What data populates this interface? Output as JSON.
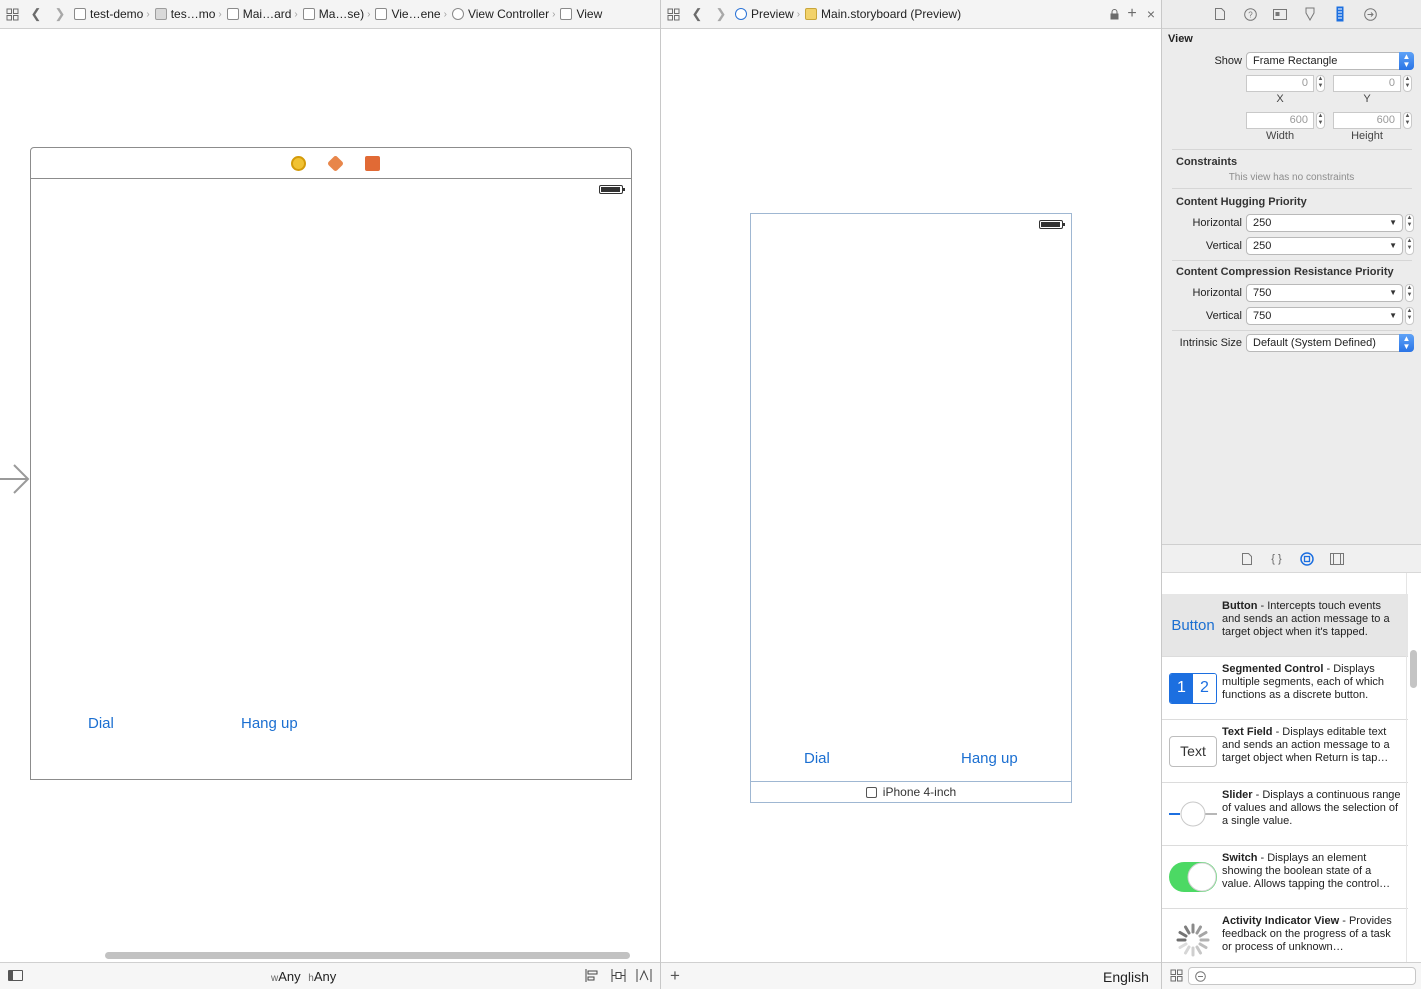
{
  "left_jumpbar": {
    "crumbs": [
      "test-demo",
      "tes…mo",
      "Mai…ard",
      "Ma…se)",
      "Vie…ene",
      "View Controller",
      "View"
    ]
  },
  "mid_jumpbar": {
    "crumbs": [
      "Preview",
      "Main.storyboard (Preview)"
    ]
  },
  "canvas": {
    "dial_label": "Dial",
    "hangup_label": "Hang up"
  },
  "preview": {
    "dial_label": "Dial",
    "hangup_label": "Hang up",
    "device_label": "iPhone 4-inch"
  },
  "size_class": {
    "w_prefix": "w",
    "w_value": "Any",
    "h_prefix": "h",
    "h_value": "Any"
  },
  "language": "English",
  "inspector": {
    "title": "View",
    "show_label": "Show",
    "show_value": "Frame Rectangle",
    "x_value": "0",
    "y_value": "0",
    "x_caption": "X",
    "y_caption": "Y",
    "width_value": "600",
    "height_value": "600",
    "width_caption": "Width",
    "height_caption": "Height",
    "constraints_header": "Constraints",
    "constraints_note": "This view has no constraints",
    "hugging_header": "Content Hugging Priority",
    "hugging_h_label": "Horizontal",
    "hugging_h_value": "250",
    "hugging_v_label": "Vertical",
    "hugging_v_value": "250",
    "compression_header": "Content Compression Resistance Priority",
    "compression_h_label": "Horizontal",
    "compression_h_value": "750",
    "compression_v_label": "Vertical",
    "compression_v_value": "750",
    "intrinsic_label": "Intrinsic Size",
    "intrinsic_value": "Default (System Defined)"
  },
  "library": {
    "items": [
      {
        "icon_text": "Button",
        "name": "Button",
        "desc": " - Intercepts touch events and sends an action message to a target object when it's tapped."
      },
      {
        "icon_text": "",
        "name": "Segmented Control",
        "desc": " - Displays multiple segments, each of which functions as a discrete button."
      },
      {
        "icon_text": "Text",
        "name": "Text Field",
        "desc": " - Displays editable text and sends an action message to a target object when Return is tap…"
      },
      {
        "icon_text": "",
        "name": "Slider",
        "desc": " - Displays a continuous range of values and allows the selection of a single value."
      },
      {
        "icon_text": "",
        "name": "Switch",
        "desc": " - Displays an element showing the boolean state of a value. Allows tapping the control…"
      },
      {
        "icon_text": "",
        "name": "Activity Indicator View",
        "desc": " - Provides feedback on the progress of a task or process of unknown…"
      }
    ],
    "segment_1": "1",
    "segment_2": "2"
  },
  "colors": {
    "ios_blue": "#1b6fd1",
    "switch_green": "#4cd964",
    "accent_blue": "#2a74e6"
  }
}
